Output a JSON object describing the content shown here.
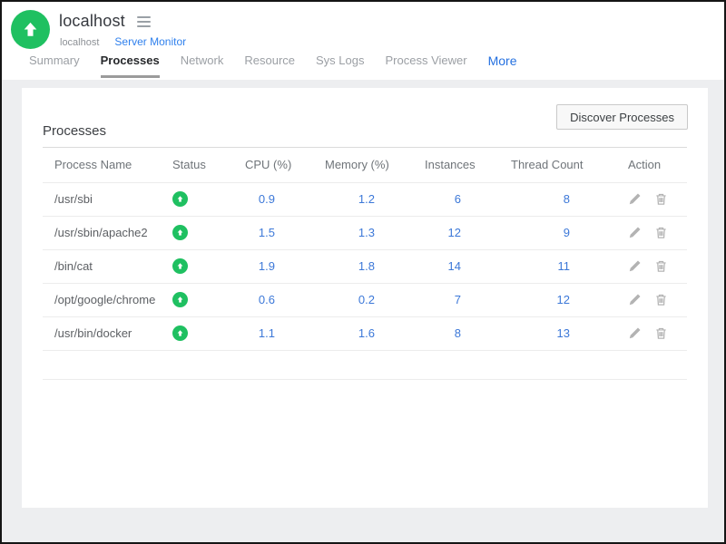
{
  "header": {
    "title": "localhost",
    "icons": {
      "logo": "up-arrow-circle",
      "menu": "hamburger-menu"
    },
    "breadcrumb": {
      "host": "localhost",
      "section_link": "Server Monitor"
    }
  },
  "tabs": {
    "active": "Processes",
    "items": [
      {
        "label": "Summary"
      },
      {
        "label": "Processes"
      },
      {
        "label": "Network"
      },
      {
        "label": "Resource"
      },
      {
        "label": "Sys Logs"
      },
      {
        "label": "Process Viewer"
      },
      {
        "label": "More"
      }
    ]
  },
  "content": {
    "discover_button_label": "Discover Processes",
    "section_title": "Processes",
    "table": {
      "columns": {
        "name": "Process Name",
        "status": "Status",
        "cpu": "CPU (%)",
        "memory": "Memory (%)",
        "instances": "Instances",
        "threads": "Thread Count",
        "action": "Action"
      },
      "row_icons": {
        "status": "up-arrow-badge",
        "edit": "pencil-icon",
        "delete": "trash-icon"
      },
      "rows": [
        {
          "name": "/usr/sbi",
          "status": "up",
          "cpu": "0.9",
          "memory": "1.2",
          "instances": "6",
          "threads": "8"
        },
        {
          "name": "/usr/sbin/apache2",
          "status": "up",
          "cpu": "1.5",
          "memory": "1.3",
          "instances": "12",
          "threads": "9"
        },
        {
          "name": "/bin/cat",
          "status": "up",
          "cpu": "1.9",
          "memory": "1.8",
          "instances": "14",
          "threads": "11"
        },
        {
          "name": "/opt/google/chrome",
          "status": "up",
          "cpu": "0.6",
          "memory": "0.2",
          "instances": "7",
          "threads": "12"
        },
        {
          "name": "/usr/bin/docker",
          "status": "up",
          "cpu": "1.1",
          "memory": "1.6",
          "instances": "8",
          "threads": "13"
        }
      ]
    }
  },
  "colors": {
    "brand_green": "#1fc061",
    "link_blue": "#2f80ed",
    "value_blue": "#3c78d8",
    "page_background": "#edeef0",
    "active_tab_underline": "#9b9b9b"
  }
}
